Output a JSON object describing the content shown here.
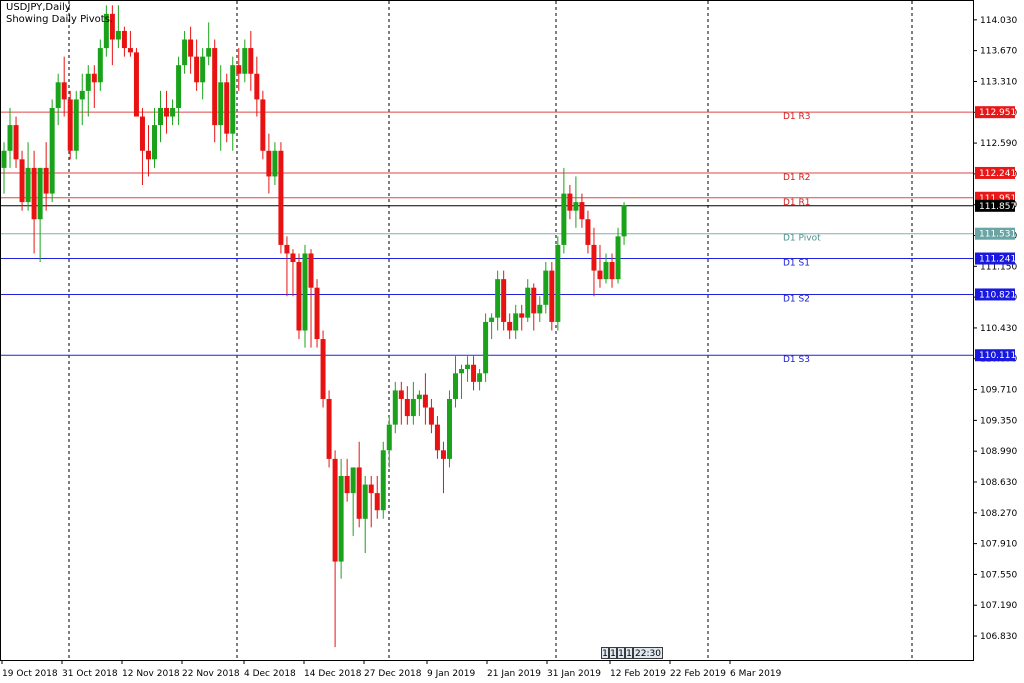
{
  "header": {
    "symbol_line": "USDJPY,Daily",
    "indicator_line": "Showing Daily Pivots."
  },
  "time_scale_box": [
    "1",
    "1",
    "1",
    "1",
    "22:30"
  ],
  "colors": {
    "bull": "#1aa31a",
    "bear": "#e81212",
    "resistance": "#e04646",
    "support": "#2222dd",
    "pivot": "#7fb0b0",
    "current": "#000000",
    "period_separator": "#000000"
  },
  "chart_data": {
    "type": "candlestick",
    "symbol": "USDJPY",
    "timeframe": "Daily",
    "ylim": [
      106.55,
      114.25
    ],
    "y_ticks": [
      "114.030",
      "113.670",
      "113.310",
      "112.950",
      "112.590",
      "112.230",
      "111.870",
      "111.510",
      "111.150",
      "110.790",
      "110.430",
      "110.070",
      "109.710",
      "109.350",
      "108.990",
      "108.630",
      "108.270",
      "107.910",
      "107.550",
      "107.190",
      "106.830"
    ],
    "x_ticks": [
      "19 Oct 2018",
      "31 Oct 2018",
      "12 Nov 2018",
      "22 Nov 2018",
      "4 Dec 2018",
      "14 Dec 2018",
      "27 Dec 2018",
      "9 Jan 2019",
      "21 Jan 2019",
      "31 Jan 2019",
      "12 Feb 2019",
      "22 Feb 2019",
      "6 Mar 2019"
    ],
    "pivot_levels": [
      {
        "label": "D1  R3",
        "value": 112.951,
        "tag": "112.951",
        "kind": "resistance"
      },
      {
        "label": "D1  R2",
        "value": 112.241,
        "tag": "112.241",
        "kind": "resistance"
      },
      {
        "label": "D1  R1",
        "value": 111.951,
        "tag": "111.951",
        "kind": "resistance"
      },
      {
        "label": "D1  Pivot",
        "value": 111.531,
        "tag": "111.531",
        "kind": "pivot"
      },
      {
        "label": "D1  S1",
        "value": 111.241,
        "tag": "111.241",
        "kind": "support"
      },
      {
        "label": "D1  S2",
        "value": 110.821,
        "tag": "110.821",
        "kind": "support"
      },
      {
        "label": "D1  S3",
        "value": 110.111,
        "tag": "110.111",
        "kind": "support"
      }
    ],
    "current_price": {
      "value": 111.857,
      "tag": "111.857"
    },
    "candles": [
      {
        "o": 112.3,
        "h": 112.6,
        "l": 112.0,
        "c": 112.5
      },
      {
        "o": 112.5,
        "h": 113.0,
        "l": 112.3,
        "c": 112.8
      },
      {
        "o": 112.8,
        "h": 112.9,
        "l": 112.3,
        "c": 112.4
      },
      {
        "o": 112.4,
        "h": 112.5,
        "l": 111.8,
        "c": 111.9
      },
      {
        "o": 111.9,
        "h": 112.6,
        "l": 111.8,
        "c": 112.3
      },
      {
        "o": 112.3,
        "h": 112.5,
        "l": 111.3,
        "c": 111.7
      },
      {
        "o": 111.7,
        "h": 112.3,
        "l": 111.2,
        "c": 112.3
      },
      {
        "o": 112.3,
        "h": 112.6,
        "l": 111.8,
        "c": 112.0
      },
      {
        "o": 112.0,
        "h": 113.1,
        "l": 111.9,
        "c": 113.0
      },
      {
        "o": 113.0,
        "h": 113.4,
        "l": 112.8,
        "c": 113.3
      },
      {
        "o": 113.3,
        "h": 113.6,
        "l": 112.9,
        "c": 113.1
      },
      {
        "o": 113.1,
        "h": 113.2,
        "l": 112.4,
        "c": 112.5
      },
      {
        "o": 112.5,
        "h": 113.2,
        "l": 112.4,
        "c": 113.1
      },
      {
        "o": 113.1,
        "h": 113.4,
        "l": 112.8,
        "c": 113.2
      },
      {
        "o": 113.2,
        "h": 113.5,
        "l": 112.9,
        "c": 113.4
      },
      {
        "o": 113.4,
        "h": 113.5,
        "l": 113.0,
        "c": 113.3
      },
      {
        "o": 113.3,
        "h": 113.8,
        "l": 113.2,
        "c": 113.7
      },
      {
        "o": 113.7,
        "h": 114.2,
        "l": 113.6,
        "c": 114.1
      },
      {
        "o": 114.1,
        "h": 114.2,
        "l": 113.5,
        "c": 113.8
      },
      {
        "o": 113.8,
        "h": 114.2,
        "l": 113.7,
        "c": 113.9
      },
      {
        "o": 113.9,
        "h": 113.95,
        "l": 113.6,
        "c": 113.7
      },
      {
        "o": 113.7,
        "h": 113.9,
        "l": 113.6,
        "c": 113.65
      },
      {
        "o": 113.65,
        "h": 113.7,
        "l": 112.9,
        "c": 112.9
      },
      {
        "o": 112.9,
        "h": 113.0,
        "l": 112.1,
        "c": 112.5
      },
      {
        "o": 112.5,
        "h": 112.8,
        "l": 112.2,
        "c": 112.4
      },
      {
        "o": 112.4,
        "h": 113.0,
        "l": 112.3,
        "c": 112.8
      },
      {
        "o": 112.8,
        "h": 113.2,
        "l": 112.6,
        "c": 113.0
      },
      {
        "o": 113.0,
        "h": 113.2,
        "l": 112.7,
        "c": 112.9
      },
      {
        "o": 112.9,
        "h": 113.1,
        "l": 112.8,
        "c": 113.0
      },
      {
        "o": 113.0,
        "h": 113.6,
        "l": 112.8,
        "c": 113.5
      },
      {
        "o": 113.5,
        "h": 113.9,
        "l": 113.4,
        "c": 113.8
      },
      {
        "o": 113.8,
        "h": 113.95,
        "l": 113.4,
        "c": 113.6
      },
      {
        "o": 113.6,
        "h": 113.8,
        "l": 113.2,
        "c": 113.3
      },
      {
        "o": 113.3,
        "h": 113.7,
        "l": 113.1,
        "c": 113.6
      },
      {
        "o": 113.6,
        "h": 114.0,
        "l": 113.5,
        "c": 113.7
      },
      {
        "o": 113.7,
        "h": 113.8,
        "l": 112.6,
        "c": 112.8
      },
      {
        "o": 112.8,
        "h": 113.5,
        "l": 112.5,
        "c": 113.3
      },
      {
        "o": 113.3,
        "h": 113.4,
        "l": 112.6,
        "c": 112.7
      },
      {
        "o": 112.7,
        "h": 113.6,
        "l": 112.5,
        "c": 113.5
      },
      {
        "o": 113.5,
        "h": 113.7,
        "l": 113.2,
        "c": 113.4
      },
      {
        "o": 113.4,
        "h": 113.8,
        "l": 113.3,
        "c": 113.7
      },
      {
        "o": 113.7,
        "h": 113.9,
        "l": 113.2,
        "c": 113.4
      },
      {
        "o": 113.4,
        "h": 113.6,
        "l": 112.9,
        "c": 113.1
      },
      {
        "o": 113.1,
        "h": 113.2,
        "l": 112.4,
        "c": 112.5
      },
      {
        "o": 112.5,
        "h": 112.7,
        "l": 112.0,
        "c": 112.2
      },
      {
        "o": 112.2,
        "h": 112.6,
        "l": 112.1,
        "c": 112.5
      },
      {
        "o": 112.5,
        "h": 112.6,
        "l": 111.3,
        "c": 111.4
      },
      {
        "o": 111.4,
        "h": 111.5,
        "l": 110.8,
        "c": 111.3
      },
      {
        "o": 111.3,
        "h": 111.35,
        "l": 110.8,
        "c": 111.2
      },
      {
        "o": 111.2,
        "h": 111.3,
        "l": 110.3,
        "c": 110.4
      },
      {
        "o": 110.4,
        "h": 111.4,
        "l": 110.2,
        "c": 111.3
      },
      {
        "o": 111.3,
        "h": 111.35,
        "l": 110.2,
        "c": 110.9
      },
      {
        "o": 110.9,
        "h": 111.0,
        "l": 110.2,
        "c": 110.3
      },
      {
        "o": 110.3,
        "h": 110.4,
        "l": 109.5,
        "c": 109.6
      },
      {
        "o": 109.6,
        "h": 109.7,
        "l": 108.8,
        "c": 108.9
      },
      {
        "o": 108.9,
        "h": 109.0,
        "l": 106.7,
        "c": 107.7
      },
      {
        "o": 107.7,
        "h": 108.9,
        "l": 107.5,
        "c": 108.7
      },
      {
        "o": 108.7,
        "h": 108.9,
        "l": 108.4,
        "c": 108.5
      },
      {
        "o": 108.5,
        "h": 108.8,
        "l": 108.0,
        "c": 108.8
      },
      {
        "o": 108.8,
        "h": 109.1,
        "l": 108.1,
        "c": 108.2
      },
      {
        "o": 108.2,
        "h": 108.7,
        "l": 107.8,
        "c": 108.6
      },
      {
        "o": 108.6,
        "h": 108.7,
        "l": 108.1,
        "c": 108.5
      },
      {
        "o": 108.5,
        "h": 108.7,
        "l": 108.2,
        "c": 108.3
      },
      {
        "o": 108.3,
        "h": 109.1,
        "l": 108.2,
        "c": 109.0
      },
      {
        "o": 109.0,
        "h": 109.4,
        "l": 108.8,
        "c": 109.3
      },
      {
        "o": 109.3,
        "h": 109.8,
        "l": 109.2,
        "c": 109.7
      },
      {
        "o": 109.7,
        "h": 109.8,
        "l": 109.3,
        "c": 109.6
      },
      {
        "o": 109.6,
        "h": 109.75,
        "l": 109.3,
        "c": 109.4
      },
      {
        "o": 109.4,
        "h": 109.8,
        "l": 109.3,
        "c": 109.6
      },
      {
        "o": 109.6,
        "h": 109.7,
        "l": 109.4,
        "c": 109.65
      },
      {
        "o": 109.65,
        "h": 109.9,
        "l": 109.3,
        "c": 109.5
      },
      {
        "o": 109.5,
        "h": 109.6,
        "l": 109.2,
        "c": 109.3
      },
      {
        "o": 109.3,
        "h": 109.4,
        "l": 108.9,
        "c": 109.0
      },
      {
        "o": 109.0,
        "h": 109.1,
        "l": 108.5,
        "c": 108.9
      },
      {
        "o": 108.9,
        "h": 109.7,
        "l": 108.8,
        "c": 109.6
      },
      {
        "o": 109.6,
        "h": 110.1,
        "l": 109.5,
        "c": 109.9
      },
      {
        "o": 109.9,
        "h": 110.0,
        "l": 109.6,
        "c": 109.95
      },
      {
        "o": 109.95,
        "h": 110.1,
        "l": 109.8,
        "c": 110.0
      },
      {
        "o": 110.0,
        "h": 110.1,
        "l": 109.7,
        "c": 109.8
      },
      {
        "o": 109.8,
        "h": 109.95,
        "l": 109.7,
        "c": 109.9
      },
      {
        "o": 109.9,
        "h": 110.6,
        "l": 109.8,
        "c": 110.5
      },
      {
        "o": 110.5,
        "h": 110.6,
        "l": 110.3,
        "c": 110.55
      },
      {
        "o": 110.55,
        "h": 111.1,
        "l": 110.4,
        "c": 111.0
      },
      {
        "o": 111.0,
        "h": 111.1,
        "l": 110.4,
        "c": 110.5
      },
      {
        "o": 110.5,
        "h": 110.6,
        "l": 110.3,
        "c": 110.4
      },
      {
        "o": 110.4,
        "h": 110.7,
        "l": 110.3,
        "c": 110.6
      },
      {
        "o": 110.6,
        "h": 110.7,
        "l": 110.4,
        "c": 110.55
      },
      {
        "o": 110.55,
        "h": 111.0,
        "l": 110.5,
        "c": 110.9
      },
      {
        "o": 110.9,
        "h": 110.95,
        "l": 110.4,
        "c": 110.6
      },
      {
        "o": 110.6,
        "h": 110.8,
        "l": 110.5,
        "c": 110.7
      },
      {
        "o": 110.7,
        "h": 111.2,
        "l": 110.6,
        "c": 111.1
      },
      {
        "o": 111.1,
        "h": 111.2,
        "l": 110.4,
        "c": 110.5
      },
      {
        "o": 110.5,
        "h": 111.5,
        "l": 110.4,
        "c": 111.4
      },
      {
        "o": 111.4,
        "h": 112.3,
        "l": 111.3,
        "c": 112.0
      },
      {
        "o": 112.0,
        "h": 112.1,
        "l": 111.7,
        "c": 111.8
      },
      {
        "o": 111.8,
        "h": 112.2,
        "l": 111.6,
        "c": 111.9
      },
      {
        "o": 111.9,
        "h": 112.0,
        "l": 111.6,
        "c": 111.7
      },
      {
        "o": 111.7,
        "h": 111.8,
        "l": 111.3,
        "c": 111.4
      },
      {
        "o": 111.4,
        "h": 111.6,
        "l": 110.8,
        "c": 111.1
      },
      {
        "o": 111.1,
        "h": 111.4,
        "l": 110.9,
        "c": 111.0
      },
      {
        "o": 111.0,
        "h": 111.3,
        "l": 110.95,
        "c": 111.2
      },
      {
        "o": 111.2,
        "h": 111.3,
        "l": 110.9,
        "c": 111.0
      },
      {
        "o": 111.0,
        "h": 111.6,
        "l": 110.95,
        "c": 111.5
      },
      {
        "o": 111.5,
        "h": 111.9,
        "l": 111.4,
        "c": 111.86
      }
    ]
  }
}
